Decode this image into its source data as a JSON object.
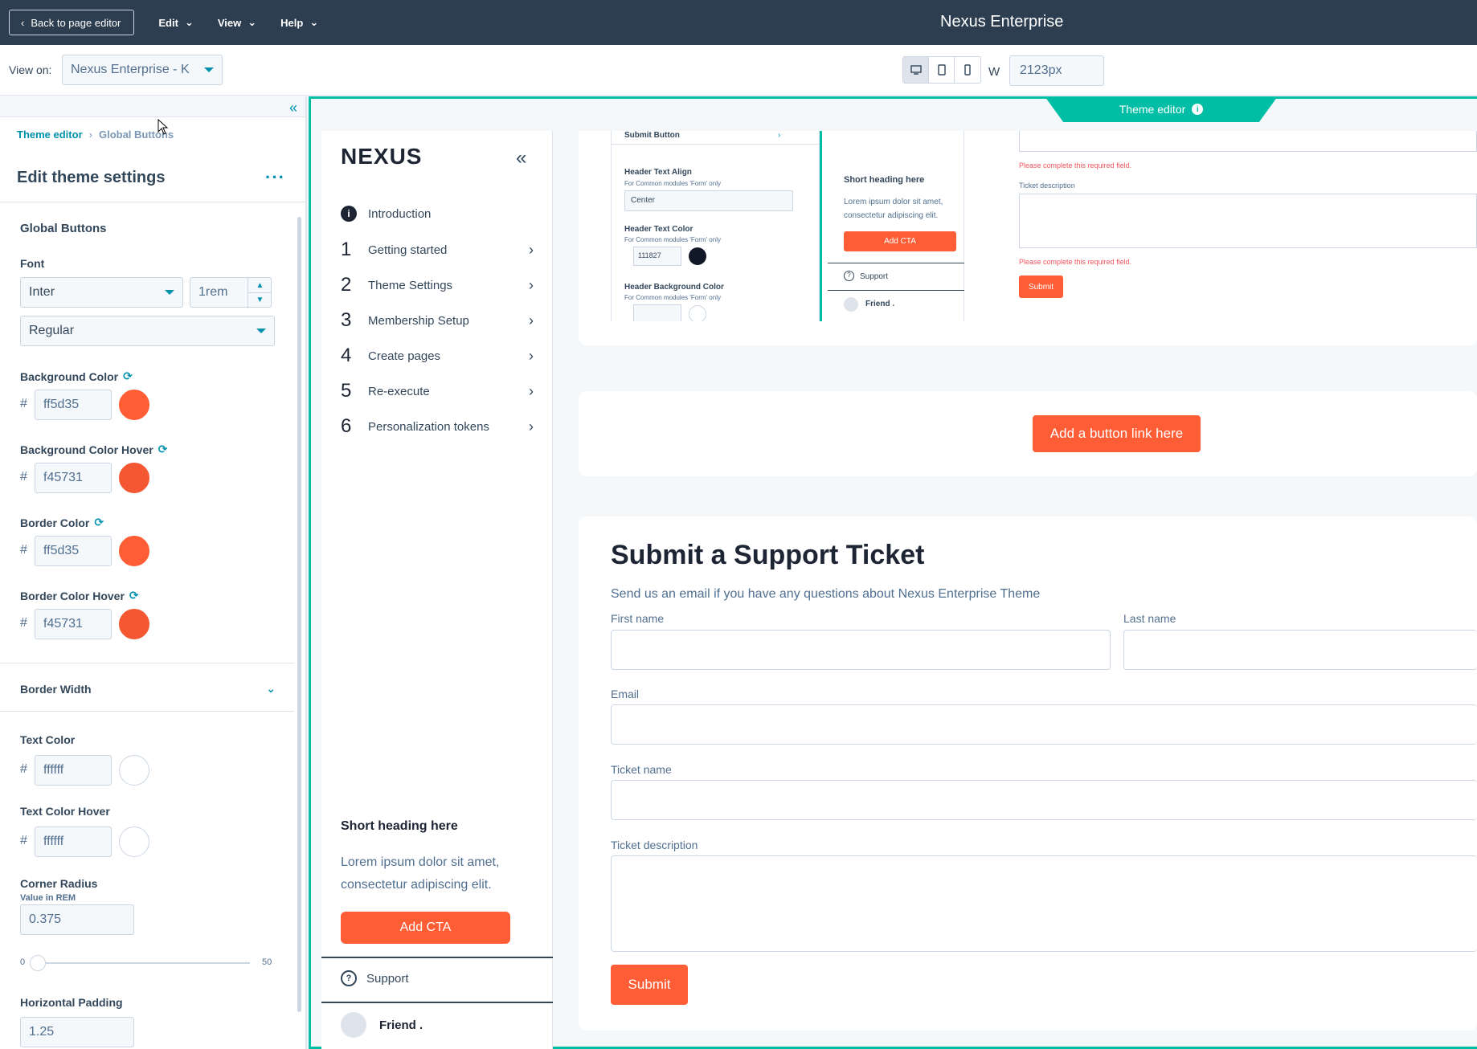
{
  "topbar": {
    "back_label": "Back to page editor",
    "menus": [
      "Edit",
      "View",
      "Help"
    ],
    "title": "Nexus Enterprise"
  },
  "viewbar": {
    "view_on_label": "View on:",
    "view_on_value": "Nexus Enterprise - K",
    "width_label": "W",
    "width_value": "2123px"
  },
  "panel": {
    "breadcrumb_root": "Theme editor",
    "breadcrumb_current": "Global Buttons",
    "title": "Edit theme settings",
    "section": "Global Buttons",
    "font_label": "Font",
    "font_family": "Inter",
    "font_size": "1rem",
    "font_weight": "Regular",
    "bg_color_label": "Background Color",
    "bg_color": "ff5d35",
    "bg_hover_label": "Background Color Hover",
    "bg_hover": "f45731",
    "border_color_label": "Border Color",
    "border_color": "ff5d35",
    "border_hover_label": "Border Color Hover",
    "border_hover": "f45731",
    "border_width_label": "Border Width",
    "text_color_label": "Text Color",
    "text_color": "ffffff",
    "text_hover_label": "Text Color Hover",
    "text_hover": "ffffff",
    "corner_label": "Corner Radius",
    "corner_sub": "Value in REM",
    "corner_value": "0.375",
    "slider_min": "0",
    "slider_max": "50",
    "hpad_label": "Horizontal Padding",
    "hpad_value": "1.25",
    "hash": "#"
  },
  "preview": {
    "theme_tab": "Theme editor",
    "logo": "NEXUS",
    "nav": [
      {
        "num": "",
        "label": "Introduction"
      },
      {
        "num": "1",
        "label": "Getting started"
      },
      {
        "num": "2",
        "label": "Theme Settings"
      },
      {
        "num": "3",
        "label": "Membership Setup"
      },
      {
        "num": "4",
        "label": "Create pages"
      },
      {
        "num": "5",
        "label": "Re-execute"
      },
      {
        "num": "6",
        "label": "Personalization tokens"
      }
    ],
    "short_heading": "Short heading here",
    "short_text": "Lorem ipsum dolor sit amet, consectetur adipiscing elit.",
    "cta": "Add CTA",
    "support": "Support",
    "friend": "Friend .",
    "button_link": "Add a button link here",
    "form_title": "Submit a Support Ticket",
    "form_sub": "Send us an email if you have any questions about Nexus Enterprise Theme",
    "first_name": "First name",
    "last_name": "Last name",
    "email": "Email",
    "ticket_name": "Ticket name",
    "ticket_desc": "Ticket description",
    "submit": "Submit"
  },
  "mini": {
    "submit_button": "Submit Button",
    "header_align": "Header Text Align",
    "for_common": "For Common modules 'Form' only",
    "center": "Center",
    "header_text_color": "Header Text Color",
    "header_text_value": "111827",
    "header_bg": "Header Background Color",
    "short_heading": "Short heading here",
    "lorem": "Lorem ipsum dolor sit amet, consectetur adipiscing elit.",
    "cta": "Add CTA",
    "support": "Support",
    "friend": "Friend .",
    "required": "Please complete this required field.",
    "ticket_desc": "Ticket description",
    "submit": "Submit"
  },
  "colors": {
    "accent": "#ff5d35",
    "hover": "#f45731",
    "teal": "#00bda5",
    "dark": "#2d3e50"
  }
}
